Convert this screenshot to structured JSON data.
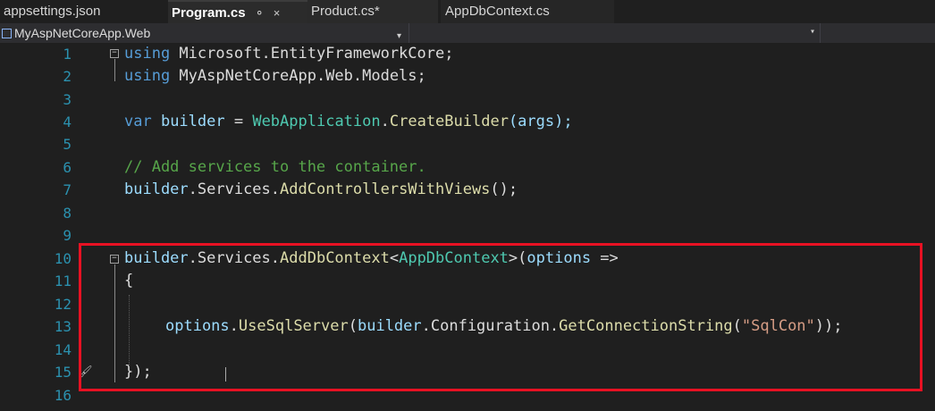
{
  "tabs": [
    {
      "label": "appsettings.json",
      "active": false
    },
    {
      "label": "Program.cs",
      "active": true,
      "pin": "⚬",
      "close": "×"
    },
    {
      "label": "Product.cs*",
      "active": false
    },
    {
      "label": "AppDbContext.cs",
      "active": false
    }
  ],
  "navbar": {
    "project": "MyAspNetCoreApp.Web",
    "dropdown_glyph": "▾"
  },
  "lines": [
    {
      "n": "1"
    },
    {
      "n": "2"
    },
    {
      "n": "3"
    },
    {
      "n": "4"
    },
    {
      "n": "5"
    },
    {
      "n": "6"
    },
    {
      "n": "7"
    },
    {
      "n": "8"
    },
    {
      "n": "9"
    },
    {
      "n": "10"
    },
    {
      "n": "11"
    },
    {
      "n": "12"
    },
    {
      "n": "13"
    },
    {
      "n": "14"
    },
    {
      "n": "15"
    },
    {
      "n": "16"
    }
  ],
  "code": {
    "l1": {
      "kw": "using",
      "rest": " Microsoft.EntityFrameworkCore;"
    },
    "l2": {
      "kw": "using",
      "rest": " MyAspNetCoreApp.Web.Models;"
    },
    "l4": {
      "kw": "var",
      "var": " builder",
      "eq": " = ",
      "type": "WebApplication",
      "dot": ".",
      "method": "CreateBuilder",
      "args": "(args);"
    },
    "l6": {
      "comment": "// Add services to the container."
    },
    "l7": {
      "var": "builder",
      "mid": ".Services.",
      "method": "AddControllersWithViews",
      "end": "();"
    },
    "l10": {
      "var": "builder",
      "mid": ".Services.",
      "method": "AddDbContext",
      "lt": "<",
      "type": "AppDbContext",
      "gt": ">(",
      "param": "options",
      "arrow": " =>"
    },
    "l11": {
      "text": "{"
    },
    "l13": {
      "param": "options",
      "d1": ".",
      "m1": "UseSqlServer",
      "p1": "(",
      "var": "builder",
      "mid": ".Configuration.",
      "m2": "GetConnectionString",
      "p2": "(",
      "str": "\"SqlCon\"",
      "end": "));"
    },
    "l15": {
      "text": "});"
    }
  },
  "colors": {
    "keyword": "#569cd6",
    "type": "#4ec9b0",
    "method": "#dcdcaa",
    "variable": "#9cdcfe",
    "string": "#d69d85",
    "comment": "#57a64a",
    "highlight_box": "#e81123"
  },
  "icons": {
    "project": "csharp-project-icon",
    "quick_action": "paintbrush-icon"
  }
}
